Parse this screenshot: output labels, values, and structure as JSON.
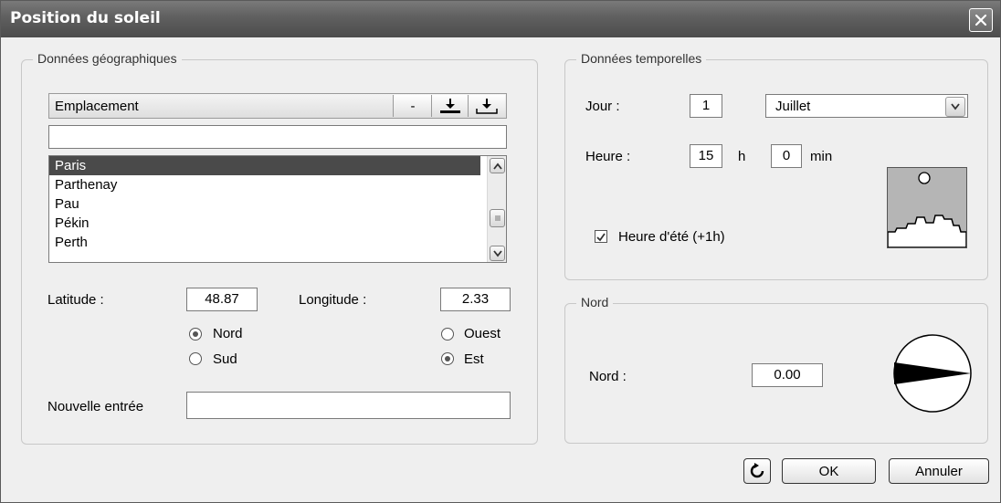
{
  "window": {
    "title": "Position du soleil"
  },
  "geo": {
    "group_label": "Données géographiques",
    "list_header": "Emplacement",
    "header_minus": "-",
    "search_value": "",
    "locations": [
      "Paris",
      "Parthenay",
      "Pau",
      "Pékin",
      "Perth"
    ],
    "selected_location": "Paris",
    "latitude_label": "Latitude :",
    "latitude_value": "48.87",
    "longitude_label": "Longitude :",
    "longitude_value": "2.33",
    "nord_label": "Nord",
    "sud_label": "Sud",
    "ouest_label": "Ouest",
    "est_label": "Est",
    "new_entry_label": "Nouvelle entrée",
    "new_entry_value": ""
  },
  "time": {
    "group_label": "Données temporelles",
    "day_label": "Jour :",
    "day_value": "1",
    "month_value": "Juillet",
    "hour_label": "Heure :",
    "hour_value": "15",
    "h_unit": "h",
    "minute_value": "0",
    "min_unit": "min",
    "dst_label": "Heure d'été (+1h)",
    "dst_checked": true
  },
  "north": {
    "group_label": "Nord",
    "nord_label": "Nord :",
    "nord_value": "0.00"
  },
  "buttons": {
    "ok": "OK",
    "cancel": "Annuler"
  }
}
